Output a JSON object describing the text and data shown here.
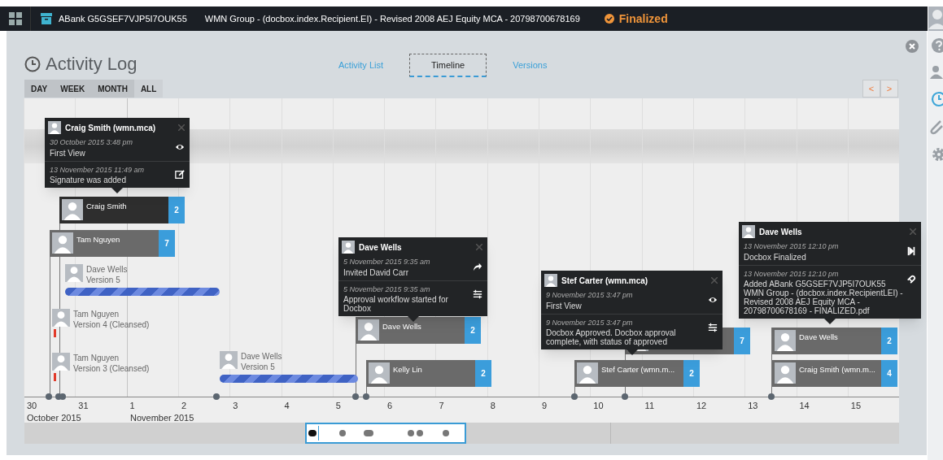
{
  "header": {
    "document_id": "ABank G5GSEF7VJP5I7OUK55",
    "title": "WMN Group - (docbox.index.Recipient.EI) - Revised 2008 AEJ Equity MCA - 20798700678169",
    "status": "Finalized"
  },
  "page_title": "Activity Log",
  "view_tabs": [
    {
      "label": "Activity List",
      "selected": false
    },
    {
      "label": "Timeline",
      "selected": true
    },
    {
      "label": "Versions",
      "selected": false
    }
  ],
  "range_buttons": [
    {
      "label": "DAY",
      "selected": false
    },
    {
      "label": "WEEK",
      "selected": false
    },
    {
      "label": "MONTH",
      "selected": false
    },
    {
      "label": "ALL",
      "selected": true
    }
  ],
  "nav_buttons": [
    "<",
    ">"
  ],
  "groups": [
    {
      "name": "Craig Smith",
      "count": "2",
      "selected": true
    },
    {
      "name": "Tam Nguyen",
      "count": "7",
      "selected": false
    },
    {
      "name": "Dave Wells",
      "count": "2",
      "selected": false
    },
    {
      "name": "Kelly Lin",
      "count": "2",
      "selected": false
    },
    {
      "name": "Stef Carter (wmn.m...",
      "count": "2",
      "selected": false
    },
    {
      "count": "7",
      "selected": false
    },
    {
      "name": "Dave Wells",
      "count": "2",
      "selected": false
    },
    {
      "name": "Craig Smith (wmn.m...",
      "count": "4",
      "selected": false
    }
  ],
  "versions": [
    {
      "name": "Dave Wells",
      "version": "Version 5",
      "kind": "active"
    },
    {
      "name": "Tam Nguyen",
      "version": "Version 4 (Cleansed)",
      "kind": "cleansed"
    },
    {
      "name": "Tam Nguyen",
      "version": "Version 3 (Cleansed)",
      "kind": "cleansed"
    },
    {
      "name": "Dave Wells",
      "version": "Version 5",
      "kind": "active"
    }
  ],
  "popups": [
    {
      "name": "Craig Smith (wmn.mca)",
      "entries": [
        {
          "date": "30 October 2015 3:48 pm",
          "text": "First View",
          "kind": "view"
        },
        {
          "date": "13 November 2015 11:49 am",
          "text": "Signature was added",
          "kind": "edit"
        }
      ]
    },
    {
      "name": "Dave Wells",
      "entries": [
        {
          "date": "5 November 2015 9:35 am",
          "text": "Invited David Carr",
          "kind": "invite"
        },
        {
          "date": "5 November 2015 9:35 am",
          "text": "Approval workflow started for Docbox",
          "kind": "workflow"
        }
      ]
    },
    {
      "name": "Stef Carter (wmn.mca)",
      "entries": [
        {
          "date": "9 November 2015 3:47 pm",
          "text": "First View",
          "kind": "view"
        },
        {
          "date": "9 November 2015 3:47 pm",
          "text": "Docbox Approved. Docbox approval complete, with status of approved",
          "kind": "workflow"
        }
      ]
    },
    {
      "name": "Dave Wells",
      "entries": [
        {
          "date": "13 November 2015 12:10 pm",
          "text": "Docbox Finalized",
          "kind": "finalize"
        },
        {
          "date": "13 November 2015 12:10 pm",
          "text": "Added ABank G5GSEF7VJP5I7OUK55 WMN Group - (docbox.index.RecipientLEI) - Revised 2008 AEJ Equity MCA - 20798700678169 - FINALIZED.pdf",
          "kind": "attach"
        }
      ]
    }
  ],
  "axis": {
    "days": [
      "30",
      "31",
      "1",
      "2",
      "3",
      "4",
      "5",
      "6",
      "7",
      "8",
      "9",
      "10",
      "11",
      "12",
      "13",
      "14",
      "15"
    ],
    "months": [
      "October 2015",
      "November 2015"
    ]
  }
}
